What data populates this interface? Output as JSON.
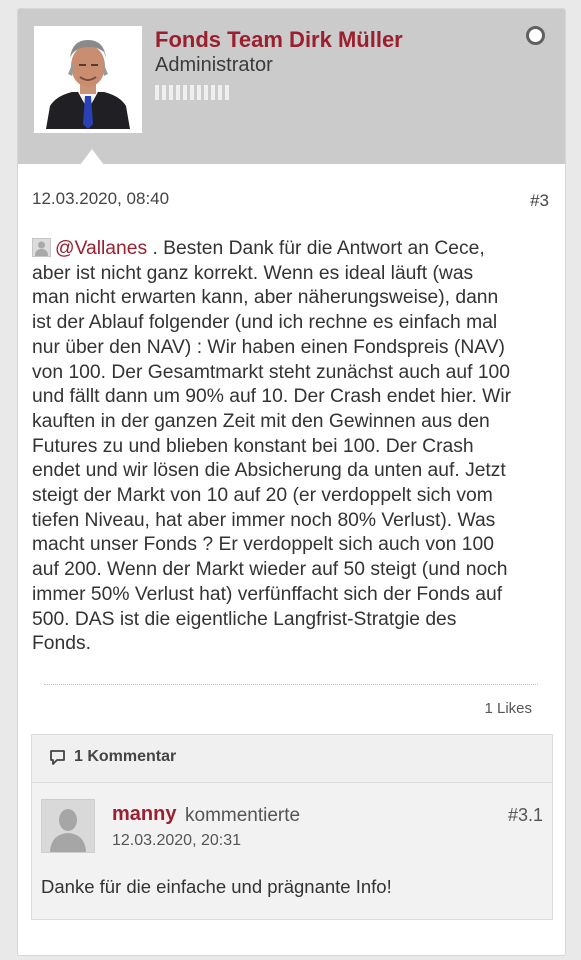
{
  "author": {
    "name": "Fonds Team Dirk Müller",
    "role": "Administrator",
    "avatar_icon": "user-photo-icon",
    "status_icon": "online-status-icon"
  },
  "post": {
    "date": "12.03.2020, 08:40",
    "number": "#3",
    "mention": "@Vallanes",
    "lines": [
      " . Besten Dank für die Antwort an Cece,",
      "aber ist nicht ganz korrekt. Wenn es ideal läuft (was",
      "man nicht erwarten kann, aber näherungsweise), dann",
      "ist der Ablauf folgender (und ich rechne es einfach mal",
      "nur über den NAV) : Wir haben einen Fondspreis (NAV)",
      "von 100. Der Gesamtmarkt steht zunächst auch auf 100",
      "und fällt dann um 90% auf 10. Der Crash endet hier. Wir",
      "kauften in der ganzen Zeit mit den Gewinnen aus den",
      "Futures zu und blieben konstant bei 100. Der Crash",
      "endet und wir lösen die Absicherung da unten auf. Jetzt",
      "steigt der Markt von 10 auf 20 (er verdoppelt sich vom",
      "tiefen Niveau, hat aber immer noch 80% Verlust). Was",
      "macht unser Fonds ? Er verdoppelt sich auch von 100",
      "auf 200. Wenn der Markt wieder auf 50 steigt (und noch",
      "immer 50% Verlust hat) verfünffacht sich der Fonds auf",
      "500. DAS ist die eigentliche Langfrist-Stratgie des",
      "Fonds."
    ],
    "likes": "1 Likes"
  },
  "comments": {
    "header": "1 Kommentar",
    "header_icon": "comment-bubble-icon",
    "items": [
      {
        "author": "manny",
        "action": "kommentierte",
        "date": "12.03.2020, 20:31",
        "number": "#3.1",
        "text": "Danke für die einfache und prägnante Info!",
        "avatar_icon": "default-user-icon"
      }
    ]
  },
  "colors": {
    "accent": "#9b1f2e",
    "header_bg": "#cbcbcb"
  }
}
